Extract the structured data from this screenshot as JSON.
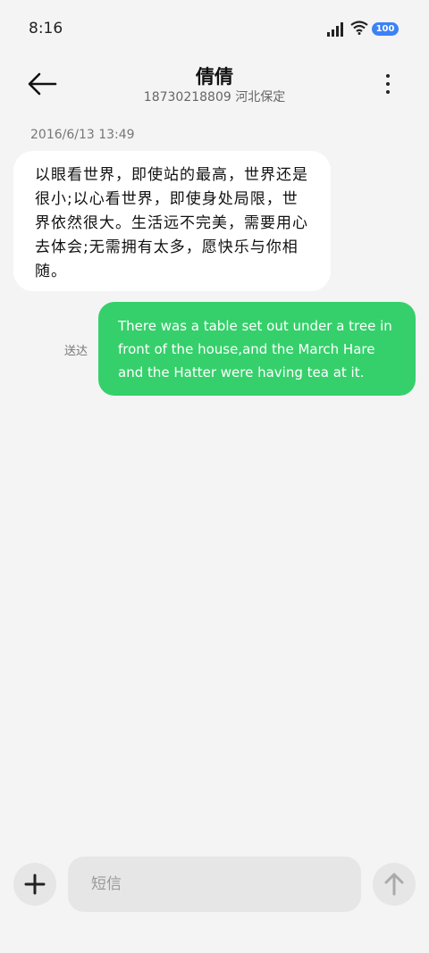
{
  "status_bar": {
    "time": "8:16",
    "battery": "100",
    "icons": [
      "signal-icon",
      "wifi-icon",
      "battery-icon"
    ]
  },
  "header": {
    "contact_name": "倩倩",
    "contact_subtitle": "18730218809 河北保定",
    "back_icon": "arrow-left-icon",
    "menu_icon": "more-vertical-icon"
  },
  "conversation": {
    "timestamp": "2016/6/13 13:49",
    "messages": [
      {
        "direction": "incoming",
        "text": "以眼看世界，即使站的最高，世界还是很小;以心看世界，即使身处局限，世界依然很大。生活远不完美，需要用心去体会;无需拥有太多，愿快乐与你相随。"
      },
      {
        "direction": "outgoing",
        "status": "送达",
        "text": "There was a table set out under a tree in front of the house,and the March Hare and the Hatter were having tea at it."
      }
    ]
  },
  "composer": {
    "placeholder": "短信",
    "add_icon": "plus-icon",
    "send_icon": "arrow-up-icon"
  },
  "colors": {
    "outgoing_bubble": "#35d06b",
    "incoming_bubble": "#ffffff",
    "background": "#f4f4f4",
    "battery_badge": "#3b82f6"
  }
}
